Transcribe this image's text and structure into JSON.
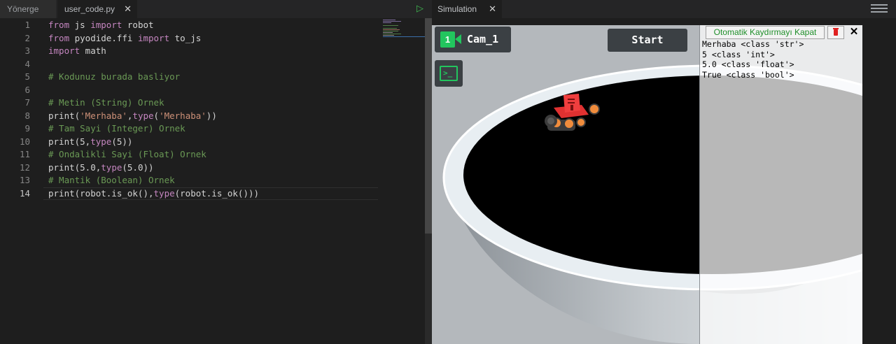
{
  "editor": {
    "tabs": [
      {
        "label": "Yönerge"
      },
      {
        "label": "user_code.py",
        "close": "✕"
      }
    ],
    "run_icon": "play-icon",
    "active_line": 14,
    "lines": [
      {
        "n": "1",
        "tokens": [
          {
            "t": "kw",
            "v": "from"
          },
          {
            "t": "tx",
            "v": " js "
          },
          {
            "t": "kw",
            "v": "import"
          },
          {
            "t": "tx",
            "v": " robot"
          }
        ]
      },
      {
        "n": "2",
        "tokens": [
          {
            "t": "kw",
            "v": "from"
          },
          {
            "t": "tx",
            "v": " pyodide.ffi "
          },
          {
            "t": "kw",
            "v": "import"
          },
          {
            "t": "tx",
            "v": " to_js"
          }
        ]
      },
      {
        "n": "3",
        "tokens": [
          {
            "t": "kw",
            "v": "import"
          },
          {
            "t": "tx",
            "v": " math"
          }
        ]
      },
      {
        "n": "4",
        "tokens": []
      },
      {
        "n": "5",
        "tokens": [
          {
            "t": "cm",
            "v": "# Kodunuz burada basliyor"
          }
        ]
      },
      {
        "n": "6",
        "tokens": []
      },
      {
        "n": "7",
        "tokens": [
          {
            "t": "cm",
            "v": "# Metin (String) Ornek"
          }
        ]
      },
      {
        "n": "8",
        "tokens": [
          {
            "t": "tx",
            "v": "print("
          },
          {
            "t": "st",
            "v": "'Merhaba'"
          },
          {
            "t": "tx",
            "v": ","
          },
          {
            "t": "bi",
            "v": "type"
          },
          {
            "t": "tx",
            "v": "("
          },
          {
            "t": "st",
            "v": "'Merhaba'"
          },
          {
            "t": "tx",
            "v": "))"
          }
        ]
      },
      {
        "n": "9",
        "tokens": [
          {
            "t": "cm",
            "v": "# Tam Sayi (Integer) Ornek"
          }
        ]
      },
      {
        "n": "10",
        "tokens": [
          {
            "t": "tx",
            "v": "print(5,"
          },
          {
            "t": "bi",
            "v": "type"
          },
          {
            "t": "tx",
            "v": "(5))"
          }
        ]
      },
      {
        "n": "11",
        "tokens": [
          {
            "t": "cm",
            "v": "# Ondalikli Sayi (Float) Ornek"
          }
        ]
      },
      {
        "n": "12",
        "tokens": [
          {
            "t": "tx",
            "v": "print(5.0,"
          },
          {
            "t": "bi",
            "v": "type"
          },
          {
            "t": "tx",
            "v": "(5.0))"
          }
        ]
      },
      {
        "n": "13",
        "tokens": [
          {
            "t": "cm",
            "v": "# Mantik (Boolean) Ornek"
          }
        ]
      },
      {
        "n": "14",
        "tokens": [
          {
            "t": "tx",
            "v": "print(robot.is_ok(),"
          },
          {
            "t": "bi",
            "v": "type"
          },
          {
            "t": "tx",
            "v": "(robot.is_ok()))"
          }
        ]
      }
    ]
  },
  "simulation": {
    "tab_label": "Simulation",
    "tab_close": "✕",
    "menu_icon": "list-icon",
    "camera": {
      "number": "1",
      "label": "Cam_1",
      "icon": "video-camera-icon"
    },
    "terminal_icon": "terminal-icon",
    "start_label": "Start"
  },
  "console": {
    "autoscroll_label": "Otomatik Kaydırmayı Kapat",
    "clear_icon": "trash-icon",
    "close_label": "✕",
    "output": [
      "Merhaba <class 'str'>",
      "5 <class 'int'>",
      "5.0 <class 'float'>",
      "True <class 'bool'>"
    ]
  },
  "colors": {
    "keyword": "#c586c0",
    "comment": "#6a9955",
    "string": "#ce9178",
    "accent_green": "#22c55e",
    "robot_red": "#e03131"
  }
}
